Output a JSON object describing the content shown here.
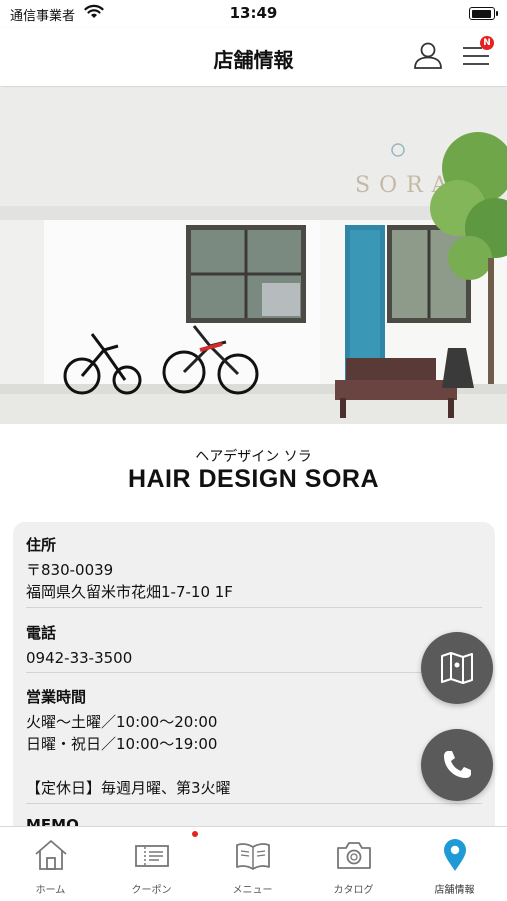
{
  "status_bar": {
    "carrier": "通信事業者",
    "time": "13:49"
  },
  "header": {
    "title": "店舗情報",
    "menu_badge": "N"
  },
  "hero_sign": "SORA",
  "shop": {
    "kana": "ヘアデザイン ソラ",
    "name": "HAIR DESIGN SORA"
  },
  "sections": {
    "address": {
      "label": "住所",
      "lines": [
        "〒830-0039",
        "福岡県久留米市花畑1-7-10 1F"
      ]
    },
    "phone": {
      "label": "電話",
      "lines": [
        "0942-33-3500"
      ]
    },
    "hours": {
      "label": "営業時間",
      "lines": [
        "火曜〜土曜／10:00〜20:00",
        "日曜・祝日／10:00〜19:00",
        "",
        "【定休日】毎週月曜、第3火曜"
      ]
    },
    "memo": {
      "label": "MEMO"
    }
  },
  "tabs": [
    {
      "label": "ホーム",
      "icon": "home-icon"
    },
    {
      "label": "クーポン",
      "icon": "coupon-icon"
    },
    {
      "label": "メニュー",
      "icon": "menu-book-icon"
    },
    {
      "label": "カタログ",
      "icon": "camera-icon"
    },
    {
      "label": "店舗情報",
      "icon": "location-pin-icon"
    }
  ],
  "colors": {
    "accent": "#1e9bd7",
    "badge": "#e52222",
    "fab": "#5a5a5a",
    "card": "#f0f0f0"
  }
}
